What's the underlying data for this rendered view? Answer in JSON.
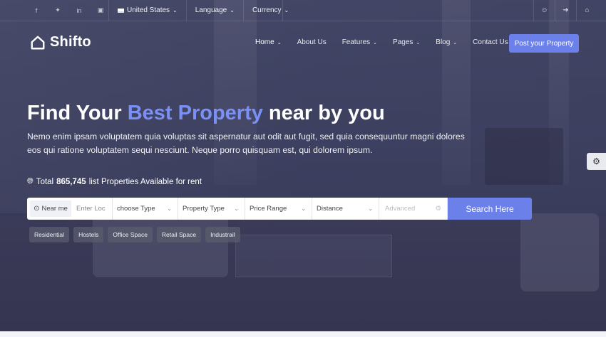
{
  "topbar": {
    "social_icons": [
      "facebook-icon",
      "twitter-icon",
      "linkedin-icon",
      "instagram-icon"
    ],
    "country": "United States",
    "language": "Language",
    "currency": "Currency",
    "right_icons": [
      "user-icon",
      "sign-out-icon",
      "home-icon"
    ]
  },
  "brand": {
    "name": "Shifto"
  },
  "nav": {
    "items": [
      {
        "label": "Home",
        "has_dropdown": true
      },
      {
        "label": "About Us",
        "has_dropdown": false
      },
      {
        "label": "Features",
        "has_dropdown": true
      },
      {
        "label": "Pages",
        "has_dropdown": true
      },
      {
        "label": "Blog",
        "has_dropdown": true
      },
      {
        "label": "Contact Us",
        "has_dropdown": false
      }
    ],
    "cta": "Post your Property"
  },
  "hero": {
    "title_pre": "Find Your ",
    "title_accent": "Best Property",
    "title_post": " near by you",
    "description": "Nemo enim ipsam voluptatem quia voluptas sit aspernatur aut odit aut fugit, sed quia consequuntur magni dolores eos qui ratione voluptatem sequi nesciunt. Neque porro quisquam est, qui dolorem ipsum.",
    "total_prefix": "Total",
    "total_count": "865,745",
    "total_suffix": "list Properties Available for rent"
  },
  "search": {
    "near_me": "Near me",
    "location_placeholder": "Enter Loc",
    "type": "choose Type",
    "property_type": "Property Type",
    "price_range": "Price Range",
    "distance": "Distance",
    "advanced": "Advanced",
    "button": "Search Here"
  },
  "tags": [
    "Residential",
    "Hostels",
    "Office Space",
    "Retail Space",
    "Industrail"
  ],
  "colors": {
    "accent": "#6c80ea",
    "accent_text": "#7b90f5"
  }
}
